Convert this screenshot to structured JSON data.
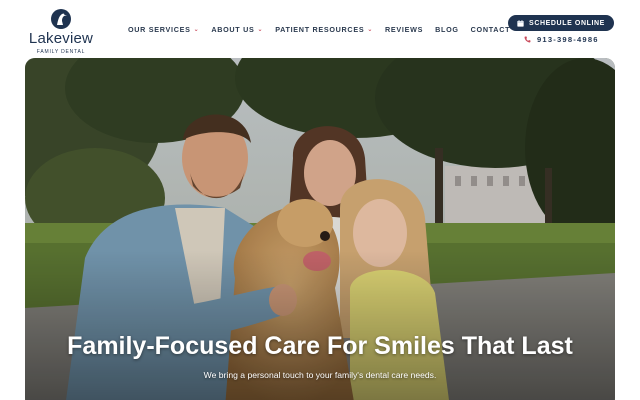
{
  "brand": {
    "name": "Lakeview",
    "tagline": "FAMILY DENTAL",
    "mark_icon": "heron-bird-icon",
    "primary_color": "#1f3350",
    "accent_color": "#c94a5b"
  },
  "nav": {
    "items": [
      {
        "label": "OUR SERVICES",
        "has_dropdown": true
      },
      {
        "label": "ABOUT US",
        "has_dropdown": true
      },
      {
        "label": "PATIENT RESOURCES",
        "has_dropdown": true
      },
      {
        "label": "REVIEWS",
        "has_dropdown": false
      },
      {
        "label": "BLOG",
        "has_dropdown": false
      },
      {
        "label": "CONTACT",
        "has_dropdown": false
      }
    ]
  },
  "cta": {
    "label": "SCHEDULE ONLINE",
    "icon": "calendar-icon"
  },
  "contact": {
    "phone": "913-398-4986",
    "icon": "phone-icon"
  },
  "hero": {
    "title": "Family-Focused Care For Smiles That Last",
    "subtitle": "We bring a personal touch to your family's dental care needs.",
    "image_icon": "family-with-dog-photo"
  }
}
